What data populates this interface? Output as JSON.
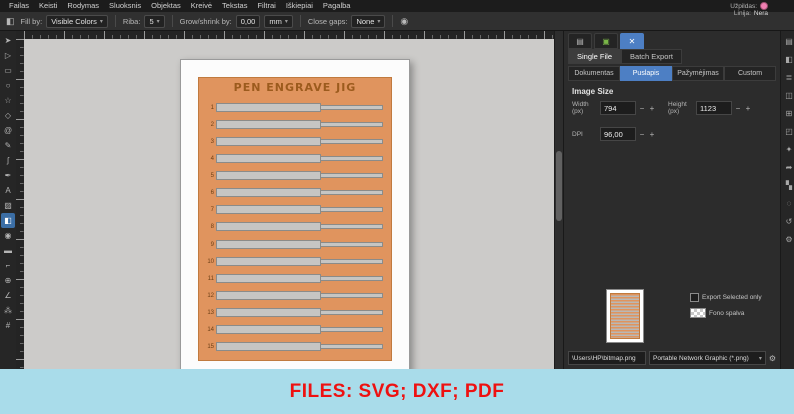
{
  "menubar": {
    "items": [
      "Failas",
      "Keisti",
      "Rodymas",
      "Sluoksnis",
      "Objektas",
      "Kreivė",
      "Tekstas",
      "Filtrai",
      "Iškiepiai",
      "Pagalba"
    ]
  },
  "toolbar": {
    "tool_icon": "◧",
    "caret": "▾",
    "fill_by_label": "Fill by:",
    "fill_by_value": "Visible Colors",
    "threshold_label": "Riba:",
    "threshold_value": "5",
    "grow_label": "Grow/shrink by:",
    "grow_value": "0,00",
    "grow_unit": "mm",
    "close_gaps_label": "Close gaps:",
    "close_gaps_value": "None"
  },
  "style_indicator": {
    "fill_label": "Užpildas:",
    "stroke_label": "Linija:",
    "stroke_value": "Nera",
    "fill_color": "#ef7fb1"
  },
  "tools": [
    {
      "name": "selector-tool",
      "glyph": "➤"
    },
    {
      "name": "node-tool",
      "glyph": "▷"
    },
    {
      "name": "rectangle-tool",
      "glyph": "▭"
    },
    {
      "name": "ellipse-tool",
      "glyph": "○"
    },
    {
      "name": "star-tool",
      "glyph": "☆"
    },
    {
      "name": "box3d-tool",
      "glyph": "◇"
    },
    {
      "name": "spiral-tool",
      "glyph": "@"
    },
    {
      "name": "pencil-tool",
      "glyph": "✎"
    },
    {
      "name": "bezier-tool",
      "glyph": "ʃ"
    },
    {
      "name": "calligraphy-tool",
      "glyph": "✒"
    },
    {
      "name": "text-tool",
      "glyph": "A"
    },
    {
      "name": "gradient-tool",
      "glyph": "▨"
    },
    {
      "name": "paint-bucket-tool",
      "glyph": "◧",
      "active": true
    },
    {
      "name": "dropper-tool",
      "glyph": "◉"
    },
    {
      "name": "eraser-tool",
      "glyph": "▬"
    },
    {
      "name": "connector-tool",
      "glyph": "⌐"
    },
    {
      "name": "zoom-tool",
      "glyph": "⊕"
    },
    {
      "name": "measure-tool",
      "glyph": "∠"
    },
    {
      "name": "spray-tool",
      "glyph": "⁂"
    },
    {
      "name": "mesh-tool",
      "glyph": "#"
    }
  ],
  "canvas": {
    "title": "PEN ENGRAVE JIG",
    "slot_numbers": [
      "1",
      "2",
      "3",
      "4",
      "5",
      "6",
      "7",
      "8",
      "9",
      "10",
      "11",
      "12",
      "13",
      "14",
      "15"
    ]
  },
  "export_panel": {
    "dialog_tabs": [
      {
        "name": "document-dialog-tab",
        "glyph": "▤"
      },
      {
        "name": "swatches-dialog-tab",
        "glyph": "▣",
        "color": "#7ab648"
      },
      {
        "name": "export-dialog-tab",
        "glyph": "✕",
        "color": "#ffffff",
        "bg": "#4d7fc4"
      }
    ],
    "file_tabs": [
      "Single File",
      "Batch Export"
    ],
    "active_file_tab": "Single File",
    "area_tabs": [
      "Dokumentas",
      "Puslapis",
      "Pažymėjimas",
      "Custom"
    ],
    "active_area_tab": "Puslapis",
    "image_size_label": "Image Size",
    "width_label": "Width",
    "width_unit": "(px)",
    "width_value": "794",
    "height_label": "Height",
    "height_unit": "(px)",
    "height_value": "1123",
    "dpi_label": "DPI",
    "dpi_value": "96,00",
    "minus": "−",
    "plus": "+",
    "export_selected_label": "Export Selected only",
    "background_label": "Fono spalva",
    "filename": "\\Users\\HP\\bitmap.png",
    "format": "Portable Network Graphic (*.png)",
    "gear_icon": "⚙"
  },
  "dock_icons": [
    {
      "name": "swatches-icon",
      "glyph": "▤"
    },
    {
      "name": "fill-stroke-icon",
      "glyph": "◧"
    },
    {
      "name": "layers-icon",
      "glyph": "≣"
    },
    {
      "name": "objects-icon",
      "glyph": "◫"
    },
    {
      "name": "align-icon",
      "glyph": "⊞"
    },
    {
      "name": "transform-icon",
      "glyph": "◰"
    },
    {
      "name": "symbols-icon",
      "glyph": "✦"
    },
    {
      "name": "export-icon",
      "glyph": "➦"
    },
    {
      "name": "xml-editor-icon",
      "glyph": "▚"
    },
    {
      "name": "find-icon",
      "glyph": "◌"
    },
    {
      "name": "undo-history-icon",
      "glyph": "↺"
    },
    {
      "name": "preferences-icon",
      "glyph": "⚙"
    }
  ],
  "banner": {
    "text": "FILES: SVG; DXF; PDF"
  },
  "colors": {
    "design_orange": "#e0945e",
    "design_border": "#c07a3e",
    "slot_gray": "#c6c5c3",
    "banner_bg": "#a9dcea",
    "banner_text": "#ee1111",
    "accent_blue": "#4d7fc4",
    "fill_indicator_pink": "#ef7fb1"
  }
}
